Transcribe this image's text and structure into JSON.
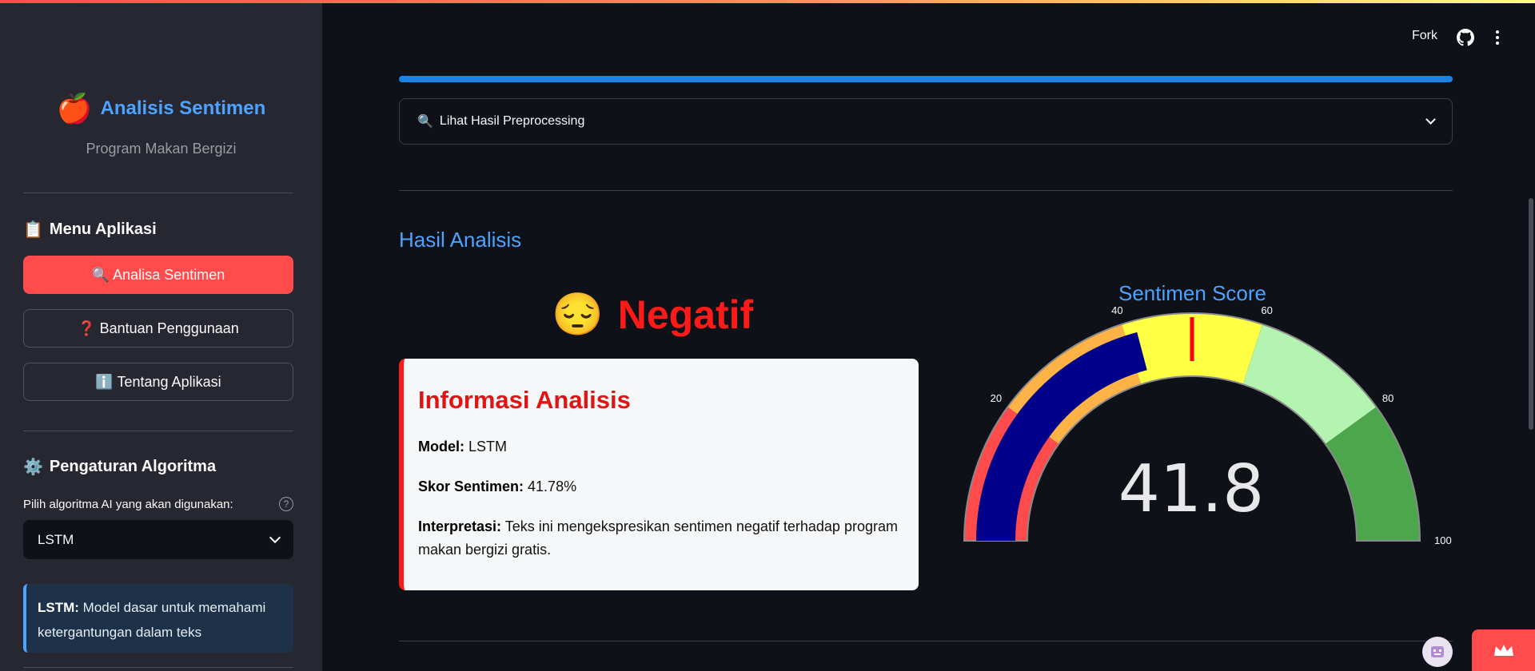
{
  "brand": {
    "title": "Analisis Sentimen",
    "subtitle": "Program Makan Bergizi",
    "icon": "apple-icon"
  },
  "sidebar": {
    "menu_heading": "Menu Aplikasi",
    "menu_icon": "clipboard-icon",
    "menu": [
      {
        "label": "🔍 Analisa Sentimen",
        "active": true
      },
      {
        "label": "❓ Bantuan Penggunaan",
        "active": false
      },
      {
        "label": "ℹ️ Tentang Aplikasi",
        "active": false
      }
    ],
    "settings_heading": "Pengaturan Algoritma",
    "settings_icon": "gear-icon",
    "select_label": "Pilih algoritma AI yang akan digunakan:",
    "select_value": "LSTM",
    "info_bold": "LSTM:",
    "info_text": " Model dasar untuk memahami ketergantungan dalam teks"
  },
  "header": {
    "fork": "Fork",
    "github": "github-icon",
    "menu": "more-vert-icon"
  },
  "main": {
    "progress": 1.0,
    "expander_label": "Lihat Hasil Preprocessing",
    "section_title": "Hasil Analisis",
    "verdict": {
      "emoji": "😔",
      "label": "Negatif"
    },
    "card": {
      "title": "Informasi Analisis",
      "model_label": "Model:",
      "model_value": " LSTM",
      "score_label": "Skor Sentimen:",
      "score_value": " 41.78%",
      "interp_label": "Interpretasi:",
      "interp_value": " Teks ini mengekspresikan sentimen negatif terhadap program makan bergizi gratis."
    },
    "gauge": {
      "title": "Sentimen Score",
      "value": 41.8,
      "value_text": "41.8",
      "min": 0,
      "max": 100,
      "threshold": 50,
      "ticks": [
        "0",
        "20",
        "40",
        "60",
        "80",
        "100"
      ],
      "steps": [
        {
          "from": 0,
          "to": 20,
          "color": "#ff4b4b"
        },
        {
          "from": 20,
          "to": 40,
          "color": "#ffb347"
        },
        {
          "from": 40,
          "to": 60,
          "color": "#ffff44"
        },
        {
          "from": 60,
          "to": 80,
          "color": "#b3f5b0"
        },
        {
          "from": 80,
          "to": 100,
          "color": "#4ca64c"
        }
      ],
      "bar_color": "#00008b",
      "threshold_color": "#ff0000"
    }
  },
  "colors": {
    "accent": "#ff4b4b",
    "link": "#4da3ff",
    "negative": "#ff1a1a"
  }
}
